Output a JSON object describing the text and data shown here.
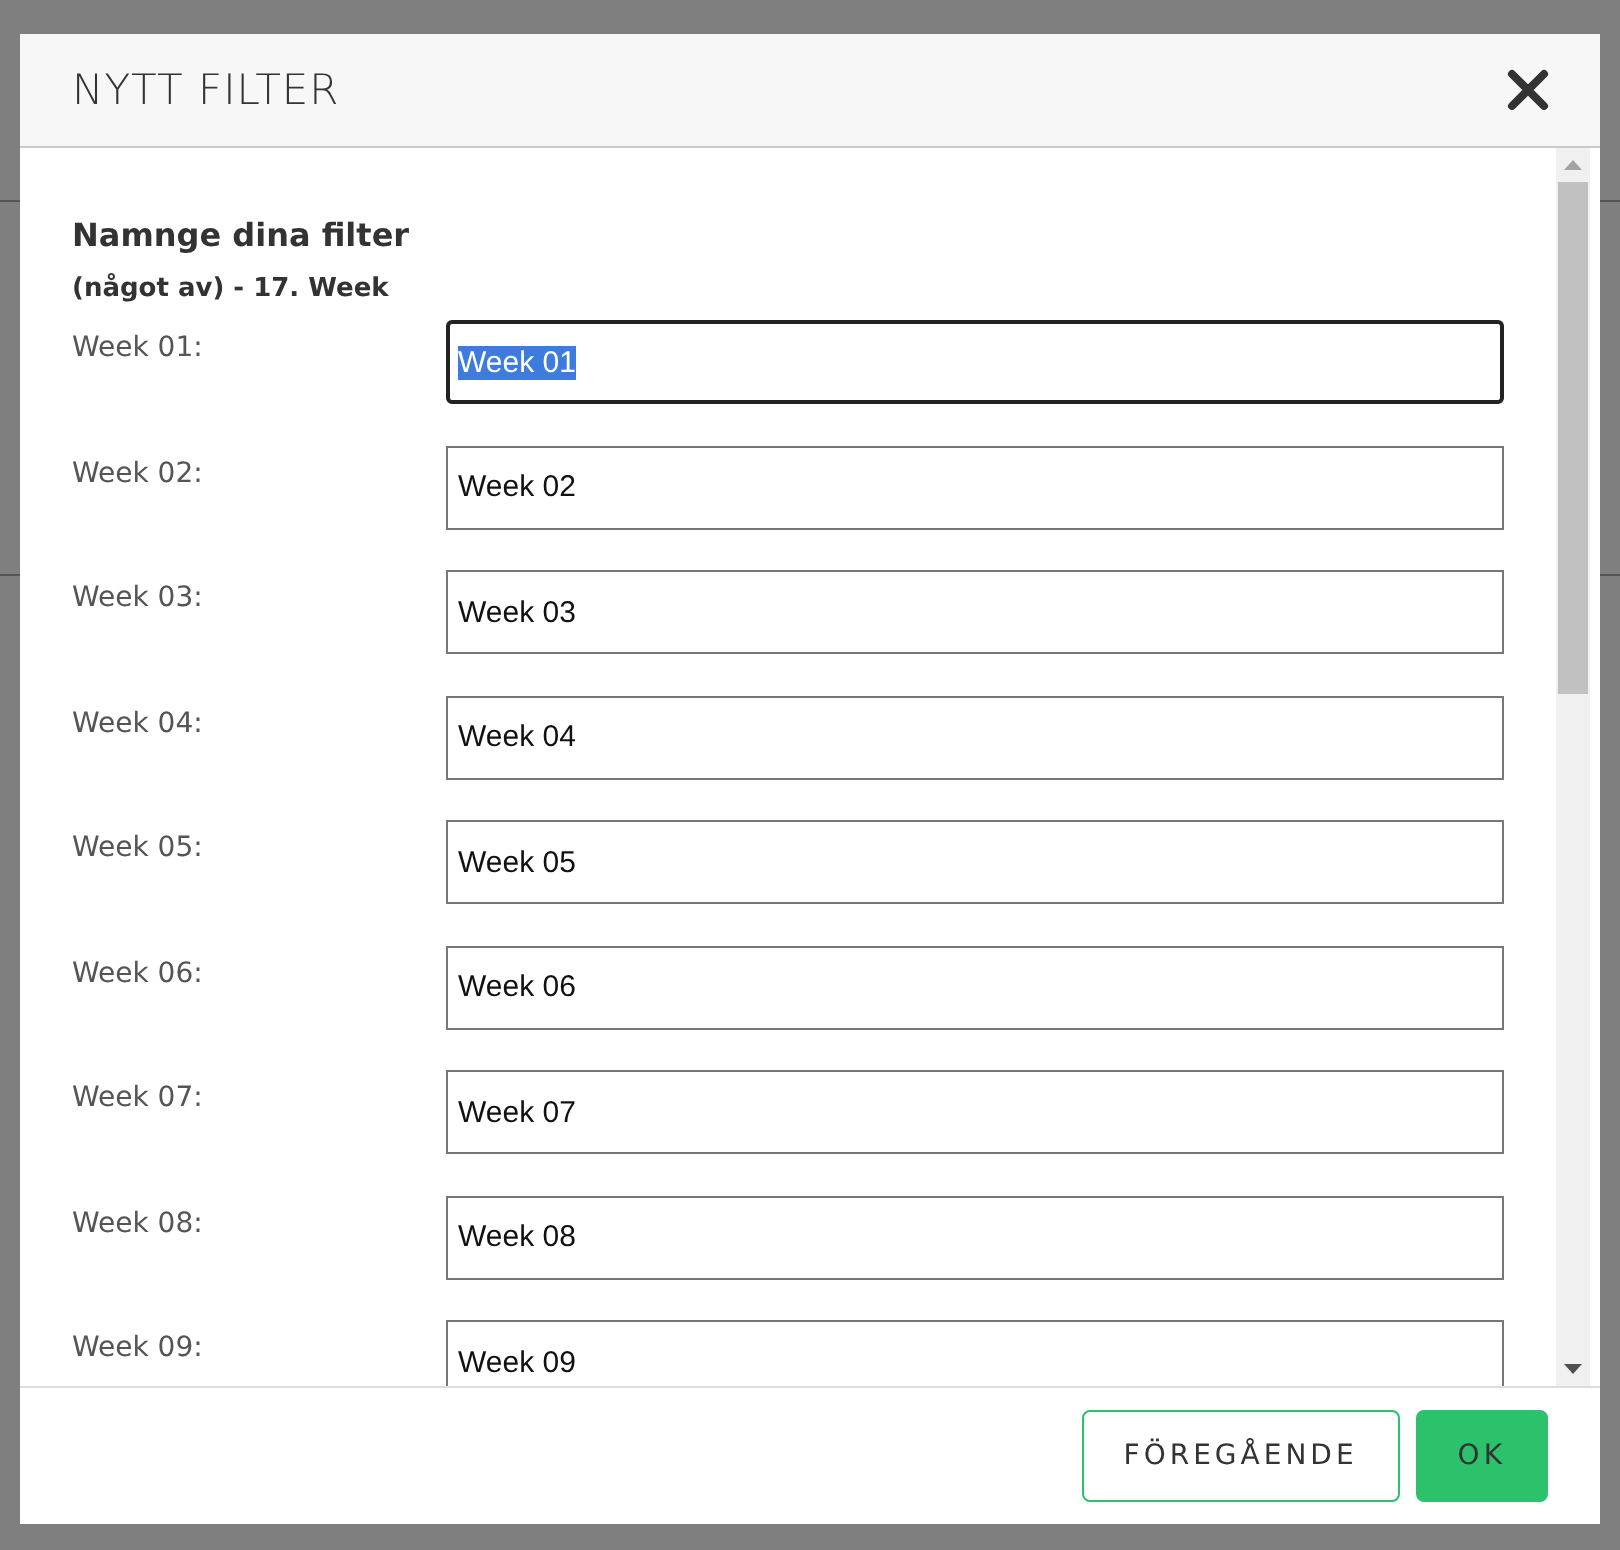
{
  "dialog": {
    "title": "NYTT FILTER",
    "heading": "Namnge dina filter",
    "subheading": "(något av) - 17. Week",
    "fields": [
      {
        "label": "Week 01:",
        "value": "Week 01",
        "focused": true
      },
      {
        "label": "Week 02:",
        "value": "Week 02",
        "focused": false
      },
      {
        "label": "Week 03:",
        "value": "Week 03",
        "focused": false
      },
      {
        "label": "Week 04:",
        "value": "Week 04",
        "focused": false
      },
      {
        "label": "Week 05:",
        "value": "Week 05",
        "focused": false
      },
      {
        "label": "Week 06:",
        "value": "Week 06",
        "focused": false
      },
      {
        "label": "Week 07:",
        "value": "Week 07",
        "focused": false
      },
      {
        "label": "Week 08:",
        "value": "Week 08",
        "focused": false
      },
      {
        "label": "Week 09:",
        "value": "Week 09",
        "focused": false
      }
    ],
    "buttons": [
      {
        "label": "FÖREGÅENDE",
        "kind": "secondary"
      },
      {
        "label": "OK",
        "kind": "primary"
      }
    ]
  }
}
